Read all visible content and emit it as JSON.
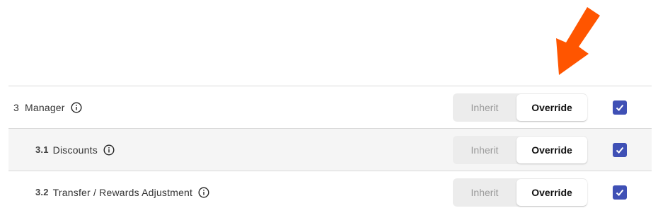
{
  "permissions": {
    "rows": [
      {
        "number": "3",
        "label": "Manager",
        "inherit_label": "Inherit",
        "override_label": "Override",
        "selected": "Override",
        "checked": true
      },
      {
        "number": "3.1",
        "label": "Discounts",
        "inherit_label": "Inherit",
        "override_label": "Override",
        "selected": "Override",
        "checked": true
      },
      {
        "number": "3.2",
        "label": "Transfer / Rewards Adjustment",
        "inherit_label": "Inherit",
        "override_label": "Override",
        "selected": "Override",
        "checked": true
      }
    ]
  },
  "colors": {
    "arrow": "#ff5500",
    "checkbox": "#3f50b5",
    "toggle_bg": "#ececec"
  }
}
